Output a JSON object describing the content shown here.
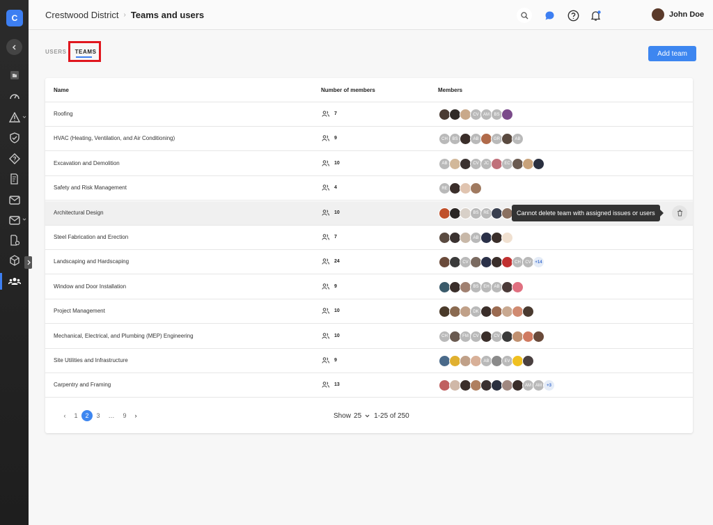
{
  "app": {
    "logo_letter": "C"
  },
  "breadcrumb": {
    "parent": "Crestwood District",
    "current": "Teams and users"
  },
  "header": {
    "user_name": "John Doe"
  },
  "tabs": [
    {
      "label": "USERS"
    },
    {
      "label": "TEAMS"
    }
  ],
  "actions": {
    "add_team": "Add team"
  },
  "table": {
    "columns": {
      "name": "Name",
      "count": "Number of members",
      "members": "Members"
    },
    "rows": [
      {
        "name": "Roofing",
        "count": "7",
        "members": [
          "p:#4a3b33",
          "p:#2f2a28",
          "p:#c9a98a",
          "CV",
          "AM",
          "BS",
          "p:#7a4a8a"
        ]
      },
      {
        "name": "HVAC (Heating, Ventilation, and Air Conditioning)",
        "count": "9",
        "members": [
          "CH",
          "BS",
          "p:#3a2e2a",
          "AB",
          "p:#b06a4a",
          "GR",
          "p:#5a4a40",
          "AB"
        ]
      },
      {
        "name": "Excavation and Demolition",
        "count": "10",
        "members": [
          "AB",
          "p:#d2b89a",
          "p:#3a3230",
          "CV",
          "JC",
          "p:#c0707a",
          "EC",
          "p:#6a5a50",
          "p:#c8a27a",
          "p:#2a3040"
        ]
      },
      {
        "name": "Safety and Risk Management",
        "count": "4",
        "members": [
          "RE",
          "p:#3a2e2a",
          "p:#e0c4b0",
          "p:#a07a60"
        ]
      },
      {
        "name": "Architectural Design",
        "count": "10",
        "members": [
          "p:#c0502a",
          "p:#2a2624",
          "p:#d8d0c8",
          "BS",
          "RE",
          "p:#3a4050",
          "p:#8a7060"
        ]
      },
      {
        "name": "Steel Fabrication and Erection",
        "count": "7",
        "members": [
          "p:#5a4a40",
          "p:#3a3230",
          "p:#c8b8a8",
          "AB",
          "p:#2a3048",
          "p:#3a2e2a",
          "p:#f0e0d0"
        ]
      },
      {
        "name": "Landscaping and Hardscaping",
        "count": "24",
        "members": [
          "p:#6a4a3a",
          "p:#3a3a3a",
          "CV",
          "p:#7a6a60",
          "p:#2a3048",
          "p:#3a2e2a",
          "p:#c03030",
          "CH",
          "CV",
          "+14"
        ]
      },
      {
        "name": "Window and Door Installation",
        "count": "9",
        "members": [
          "p:#3a5a6a",
          "p:#3a2e2a",
          "p:#a08070",
          "BS",
          "EH",
          "AB",
          "p:#4a3a38",
          "p:#e07080"
        ]
      },
      {
        "name": "Project Management",
        "count": "10",
        "members": [
          "p:#4a3a2a",
          "p:#8a6a50",
          "p:#c0a088",
          "DK",
          "p:#3a2e2a",
          "p:#9a6a50",
          "p:#c8a890",
          "p:#d08a70",
          "p:#4a3a30"
        ]
      },
      {
        "name": "Mechanical, Electrical, and Plumbing (MEP) Engineering",
        "count": "10",
        "members": [
          "CH",
          "p:#6a5a50",
          "FM",
          "CV",
          "p:#3a2e2a",
          "CV",
          "p:#3a3a3a",
          "p:#c09070",
          "p:#d07a60",
          "p:#6a4a3a"
        ]
      },
      {
        "name": "Site Utilities and Infrastructure",
        "count": "9",
        "members": [
          "p:#4a6a8a",
          "p:#e0b030",
          "p:#c0a088",
          "p:#d8b098",
          "AB",
          "p:#8a8a8a",
          "EV",
          "p:#f0c020",
          "p:#4a4040"
        ]
      },
      {
        "name": "Carpentry and Framing",
        "count": "13",
        "members": [
          "p:#c06060",
          "p:#d0b8a8",
          "p:#3a2e2a",
          "p:#b08060",
          "p:#3a3030",
          "p:#2a3040",
          "p:#a08880",
          "p:#3a2e2a",
          "AM",
          "AM",
          "+3"
        ]
      }
    ],
    "tooltip": "Cannot delete team with assigned issues or users"
  },
  "pagination": {
    "prev": "‹",
    "pages": [
      "1",
      "2",
      "3",
      "…",
      "9"
    ],
    "current": "2",
    "next": "›",
    "show_label": "Show",
    "page_size": "25",
    "range": "1-25 of 250"
  },
  "colors": {
    "accent": "#3d86f0",
    "highlight_border": "#e0161e",
    "sidebar": "#262626"
  }
}
